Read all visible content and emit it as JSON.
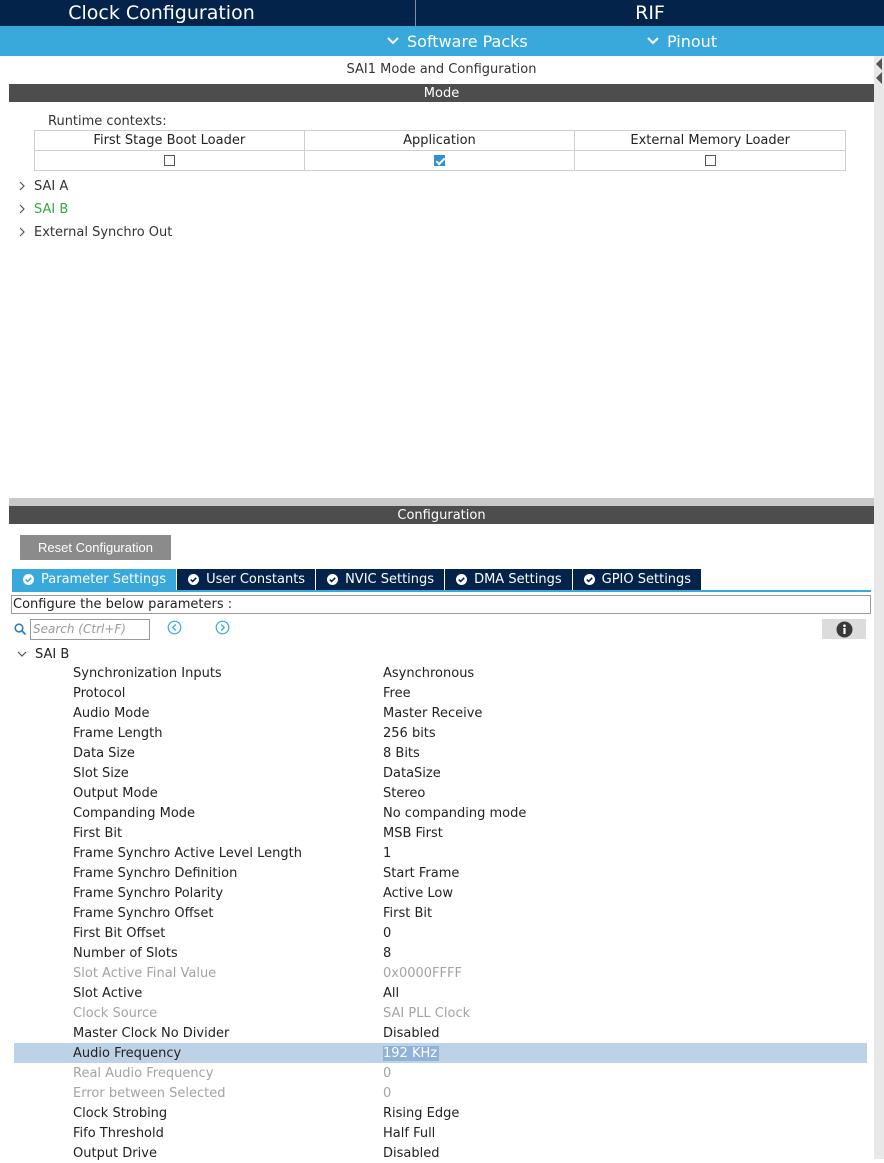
{
  "top_tabs": {
    "clock": "Clock Configuration",
    "rif": "RIF"
  },
  "menu": {
    "software_packs": "Software Packs",
    "pinout": "Pinout"
  },
  "mode_panel": {
    "caption": "SAI1 Mode and Configuration",
    "section_title": "Mode",
    "runtime_label": "Runtime contexts:",
    "contexts": [
      {
        "label": "First Stage Boot Loader",
        "checked": false
      },
      {
        "label": "Application",
        "checked": true
      },
      {
        "label": "External Memory Loader",
        "checked": false
      }
    ],
    "tree": [
      {
        "label": "SAI A",
        "highlight": false
      },
      {
        "label": "SAI B",
        "highlight": true
      },
      {
        "label": "External Synchro Out",
        "highlight": false
      }
    ]
  },
  "config_panel": {
    "section_title": "Configuration",
    "reset_label": "Reset Configuration",
    "tabs": [
      {
        "label": "Parameter Settings",
        "active": true
      },
      {
        "label": "User Constants",
        "active": false
      },
      {
        "label": "NVIC Settings",
        "active": false
      },
      {
        "label": "DMA Settings",
        "active": false
      },
      {
        "label": "GPIO Settings",
        "active": false
      }
    ],
    "hint": "Configure the below parameters :",
    "search_placeholder": "Search (Ctrl+F)",
    "group": "SAI B",
    "params": [
      {
        "name": "Synchronization Inputs",
        "value": "Asynchronous",
        "state": "normal"
      },
      {
        "name": "Protocol",
        "value": "Free",
        "state": "normal"
      },
      {
        "name": "Audio Mode",
        "value": "Master Receive",
        "state": "normal"
      },
      {
        "name": "Frame Length",
        "value": "256 bits",
        "state": "normal"
      },
      {
        "name": "Data Size",
        "value": "8 Bits",
        "state": "normal"
      },
      {
        "name": "Slot Size",
        "value": "DataSize",
        "state": "normal"
      },
      {
        "name": "Output Mode",
        "value": "Stereo",
        "state": "normal"
      },
      {
        "name": "Companding Mode",
        "value": "No companding mode",
        "state": "normal"
      },
      {
        "name": "First Bit",
        "value": "MSB First",
        "state": "normal"
      },
      {
        "name": "Frame Synchro Active Level Length",
        "value": "1",
        "state": "normal"
      },
      {
        "name": "Frame Synchro Definition",
        "value": "Start Frame",
        "state": "normal"
      },
      {
        "name": "Frame Synchro Polarity",
        "value": "Active Low",
        "state": "normal"
      },
      {
        "name": "Frame Synchro Offset",
        "value": "First Bit",
        "state": "normal"
      },
      {
        "name": "First Bit Offset",
        "value": "0",
        "state": "normal"
      },
      {
        "name": "Number of Slots",
        "value": "8",
        "state": "normal"
      },
      {
        "name": "Slot Active Final Value",
        "value": "0x0000FFFF",
        "state": "disabled"
      },
      {
        "name": "Slot Active",
        "value": "All",
        "state": "normal"
      },
      {
        "name": "Clock Source",
        "value": "SAI PLL Clock",
        "state": "disabled"
      },
      {
        "name": "Master Clock No Divider",
        "value": "Disabled",
        "state": "normal"
      },
      {
        "name": "Audio Frequency",
        "value": "192 KHz",
        "state": "selected"
      },
      {
        "name": "Real Audio Frequency",
        "value": "0",
        "state": "disabled"
      },
      {
        "name": "Error between Selected",
        "value": "0",
        "state": "disabled"
      },
      {
        "name": "Clock Strobing",
        "value": "Rising Edge",
        "state": "normal"
      },
      {
        "name": "Fifo Threshold",
        "value": "Half Full",
        "state": "normal"
      },
      {
        "name": "Output Drive",
        "value": "Disabled",
        "state": "normal"
      }
    ]
  },
  "colors": {
    "navy": "#03234b",
    "accent_blue": "#39a9dc",
    "section_gray": "#4d4d4d",
    "highlight_green": "#39a845",
    "selected_row": "#bdd2e6"
  },
  "icons": {
    "chevron_down": "chevron-down-icon",
    "chevron_right": "chevron-right-icon",
    "check_circle": "check-circle-icon",
    "search": "search-icon",
    "prev": "arrow-left-circle-icon",
    "next": "arrow-right-circle-icon",
    "info": "info-icon"
  }
}
